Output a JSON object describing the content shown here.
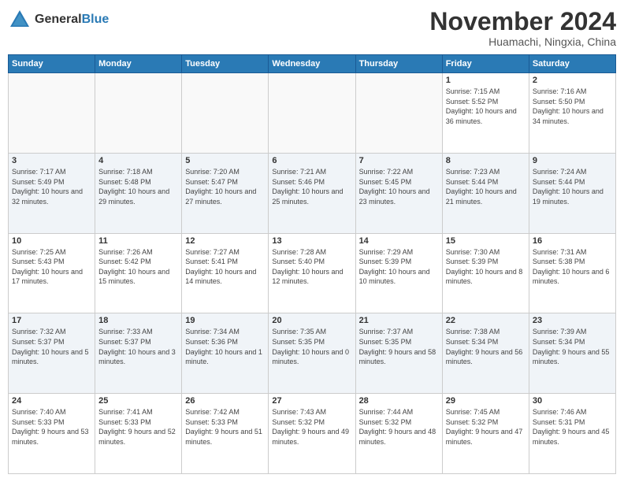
{
  "header": {
    "logo_general": "General",
    "logo_blue": "Blue",
    "month_title": "November 2024",
    "location": "Huamachi, Ningxia, China"
  },
  "weekdays": [
    "Sunday",
    "Monday",
    "Tuesday",
    "Wednesday",
    "Thursday",
    "Friday",
    "Saturday"
  ],
  "weeks": [
    [
      {
        "day": "",
        "info": ""
      },
      {
        "day": "",
        "info": ""
      },
      {
        "day": "",
        "info": ""
      },
      {
        "day": "",
        "info": ""
      },
      {
        "day": "",
        "info": ""
      },
      {
        "day": "1",
        "info": "Sunrise: 7:15 AM\nSunset: 5:52 PM\nDaylight: 10 hours and 36 minutes."
      },
      {
        "day": "2",
        "info": "Sunrise: 7:16 AM\nSunset: 5:50 PM\nDaylight: 10 hours and 34 minutes."
      }
    ],
    [
      {
        "day": "3",
        "info": "Sunrise: 7:17 AM\nSunset: 5:49 PM\nDaylight: 10 hours and 32 minutes."
      },
      {
        "day": "4",
        "info": "Sunrise: 7:18 AM\nSunset: 5:48 PM\nDaylight: 10 hours and 29 minutes."
      },
      {
        "day": "5",
        "info": "Sunrise: 7:20 AM\nSunset: 5:47 PM\nDaylight: 10 hours and 27 minutes."
      },
      {
        "day": "6",
        "info": "Sunrise: 7:21 AM\nSunset: 5:46 PM\nDaylight: 10 hours and 25 minutes."
      },
      {
        "day": "7",
        "info": "Sunrise: 7:22 AM\nSunset: 5:45 PM\nDaylight: 10 hours and 23 minutes."
      },
      {
        "day": "8",
        "info": "Sunrise: 7:23 AM\nSunset: 5:44 PM\nDaylight: 10 hours and 21 minutes."
      },
      {
        "day": "9",
        "info": "Sunrise: 7:24 AM\nSunset: 5:44 PM\nDaylight: 10 hours and 19 minutes."
      }
    ],
    [
      {
        "day": "10",
        "info": "Sunrise: 7:25 AM\nSunset: 5:43 PM\nDaylight: 10 hours and 17 minutes."
      },
      {
        "day": "11",
        "info": "Sunrise: 7:26 AM\nSunset: 5:42 PM\nDaylight: 10 hours and 15 minutes."
      },
      {
        "day": "12",
        "info": "Sunrise: 7:27 AM\nSunset: 5:41 PM\nDaylight: 10 hours and 14 minutes."
      },
      {
        "day": "13",
        "info": "Sunrise: 7:28 AM\nSunset: 5:40 PM\nDaylight: 10 hours and 12 minutes."
      },
      {
        "day": "14",
        "info": "Sunrise: 7:29 AM\nSunset: 5:39 PM\nDaylight: 10 hours and 10 minutes."
      },
      {
        "day": "15",
        "info": "Sunrise: 7:30 AM\nSunset: 5:39 PM\nDaylight: 10 hours and 8 minutes."
      },
      {
        "day": "16",
        "info": "Sunrise: 7:31 AM\nSunset: 5:38 PM\nDaylight: 10 hours and 6 minutes."
      }
    ],
    [
      {
        "day": "17",
        "info": "Sunrise: 7:32 AM\nSunset: 5:37 PM\nDaylight: 10 hours and 5 minutes."
      },
      {
        "day": "18",
        "info": "Sunrise: 7:33 AM\nSunset: 5:37 PM\nDaylight: 10 hours and 3 minutes."
      },
      {
        "day": "19",
        "info": "Sunrise: 7:34 AM\nSunset: 5:36 PM\nDaylight: 10 hours and 1 minute."
      },
      {
        "day": "20",
        "info": "Sunrise: 7:35 AM\nSunset: 5:35 PM\nDaylight: 10 hours and 0 minutes."
      },
      {
        "day": "21",
        "info": "Sunrise: 7:37 AM\nSunset: 5:35 PM\nDaylight: 9 hours and 58 minutes."
      },
      {
        "day": "22",
        "info": "Sunrise: 7:38 AM\nSunset: 5:34 PM\nDaylight: 9 hours and 56 minutes."
      },
      {
        "day": "23",
        "info": "Sunrise: 7:39 AM\nSunset: 5:34 PM\nDaylight: 9 hours and 55 minutes."
      }
    ],
    [
      {
        "day": "24",
        "info": "Sunrise: 7:40 AM\nSunset: 5:33 PM\nDaylight: 9 hours and 53 minutes."
      },
      {
        "day": "25",
        "info": "Sunrise: 7:41 AM\nSunset: 5:33 PM\nDaylight: 9 hours and 52 minutes."
      },
      {
        "day": "26",
        "info": "Sunrise: 7:42 AM\nSunset: 5:33 PM\nDaylight: 9 hours and 51 minutes."
      },
      {
        "day": "27",
        "info": "Sunrise: 7:43 AM\nSunset: 5:32 PM\nDaylight: 9 hours and 49 minutes."
      },
      {
        "day": "28",
        "info": "Sunrise: 7:44 AM\nSunset: 5:32 PM\nDaylight: 9 hours and 48 minutes."
      },
      {
        "day": "29",
        "info": "Sunrise: 7:45 AM\nSunset: 5:32 PM\nDaylight: 9 hours and 47 minutes."
      },
      {
        "day": "30",
        "info": "Sunrise: 7:46 AM\nSunset: 5:31 PM\nDaylight: 9 hours and 45 minutes."
      }
    ]
  ]
}
